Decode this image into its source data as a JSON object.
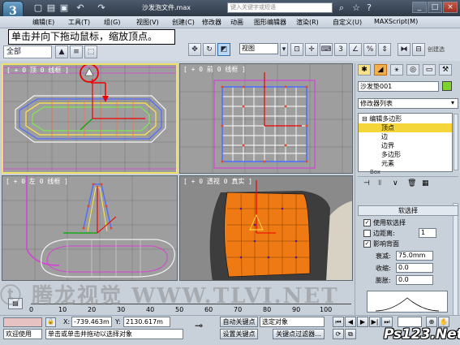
{
  "app": {
    "logo": "3",
    "title": "沙发泡文件.max",
    "search_placeholder": "键入关键字或短语",
    "window_controls": [
      "_",
      "□",
      "×"
    ]
  },
  "menu": {
    "items": [
      "编辑(E)",
      "工具(T)",
      "组(G)",
      "视图(V)",
      "创建(C)",
      "修改器",
      "动画",
      "图形编辑器",
      "渲染(R)",
      "自定义(U)",
      "MAXScript(M)"
    ]
  },
  "tooltip": {
    "text": "单击并向下拖动鼠标，缩放顶点。"
  },
  "toolbar": {
    "selection_set_label": "全部",
    "view_select_value": "视图",
    "create_label": "创建选"
  },
  "viewports": [
    {
      "label": "[ + 0 顶 0 线框 ]"
    },
    {
      "label": "[ + 0 前 0 线框 ]"
    },
    {
      "label": "[ + 0 左 0 线框 ]"
    },
    {
      "label": "[ + 0 透视 0 真实 ]"
    }
  ],
  "command_panel": {
    "object_name": "沙发垫001",
    "object_color": "#7fd22c",
    "modifier_list": "修改器列表",
    "stack": [
      {
        "label": "⊟ 编辑多边形",
        "indent": 0,
        "selected": false
      },
      {
        "label": "顶点",
        "indent": 1,
        "selected": true
      },
      {
        "label": "边",
        "indent": 1,
        "selected": false
      },
      {
        "label": "边界",
        "indent": 1,
        "selected": false
      },
      {
        "label": "多边形",
        "indent": 1,
        "selected": false
      },
      {
        "label": "元素",
        "indent": 1,
        "selected": false
      },
      {
        "label": "Box",
        "indent": 0,
        "selected": false
      }
    ],
    "soft_selection": {
      "header": "软选择",
      "use_soft_select": "使用软选择",
      "use_soft_select_checked": true,
      "edge_distance": "边距离:",
      "edge_distance_checked": false,
      "edge_distance_value": "1",
      "affect_backfacing": "影响背面",
      "affect_backfacing_checked": true,
      "falloff_label": "衰减:",
      "falloff_value": "75.0mm",
      "pinch_label": "收缩:",
      "pinch_value": "0.0",
      "bubble_label": "膨胀:",
      "bubble_value": "0.0"
    }
  },
  "timeline": {
    "ticks": [
      "0",
      "10",
      "20",
      "30",
      "40",
      "50",
      "60",
      "70",
      "80",
      "90",
      "100"
    ]
  },
  "status": {
    "welcome": "欢迎使用",
    "prompt": "单击或单击并拖动以选择对象",
    "x_label": "X:",
    "x_value": "-739.463m",
    "y_label": "Y:",
    "y_value": "2130.617m",
    "auto_key": "自动关键点",
    "selected_object": "选定对象",
    "set_key": "设置关键点",
    "key_filters": "关键点过滤器..."
  },
  "watermark": "ⓣ 腾龙视觉 WWW.TLVI.NET",
  "site_logo": "Ps123.Net"
}
